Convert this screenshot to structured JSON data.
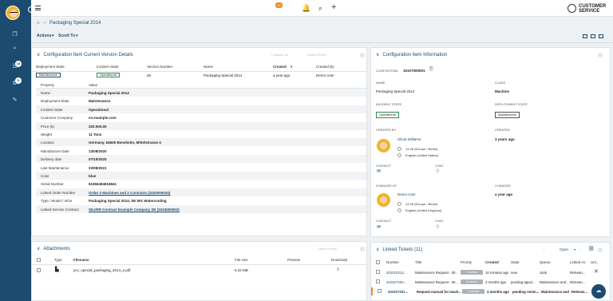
{
  "topbar": {
    "notifications_count": "12"
  },
  "brand": {
    "line1": "CUSTOMER",
    "line2": "SERVICE"
  },
  "breadcrumb": {
    "title": "Packaging Special 2014"
  },
  "actions": {
    "actions_label": "Actions",
    "scroll_label": "Scroll To"
  },
  "sidebar": {
    "badge1": "23",
    "badge2": "9"
  },
  "versions": {
    "title": "Configuration Item Current Version Details",
    "ghost1": "Collapse All",
    "ghost2": "Select Preset",
    "headers": [
      "Deployment State",
      "Incident State",
      "Version Number",
      "Name",
      "Created",
      "Created By"
    ],
    "row": {
      "deployment": "Maintenance",
      "incident": "Operational",
      "version": "26",
      "name": "Packaging Special 2014",
      "created": "a year ago",
      "created_by": "Demo User"
    },
    "prop_header": "Property",
    "value_header": "Value",
    "props": [
      {
        "k": "Name",
        "v": "Packaging Special 2014"
      },
      {
        "k": "Deployment State",
        "v": "Maintenance"
      },
      {
        "k": "Incident State",
        "v": "Operational"
      },
      {
        "k": "Customer Company",
        "v": "ex.example.com"
      },
      {
        "k": "Price (€)",
        "v": "220.000,00"
      },
      {
        "k": "Weight",
        "v": "11 Tons"
      },
      {
        "k": "Location",
        "v": "Germany, 64625 Bensheim, Mittelstrasse 4"
      },
      {
        "k": "Manufacture Date",
        "v": "13/08/2020"
      },
      {
        "k": "Delivery date",
        "v": "07/10/2020"
      },
      {
        "k": "Last Maintenance",
        "v": "23/09/2021"
      },
      {
        "k": "Color",
        "v": "blue"
      },
      {
        "k": "Serial Number",
        "v": "61556484616841"
      },
      {
        "k": "Linked Order Number",
        "v": "Order 2 Machines and 2 Contracts (1020000034)"
      },
      {
        "k": "Type / Model / Infos",
        "v": "Packaging Special 2014, SE 501 Watercooling"
      },
      {
        "k": "Linked Service Contract",
        "v": "SILVER Contract Example Company SE (1024000002)"
      }
    ]
  },
  "attachments": {
    "title": "Attachments",
    "ghost": "Select Preset",
    "headers": {
      "type": "Type",
      "filename": "Filename",
      "size": "File size",
      "preview": "Preview",
      "download": "Download"
    },
    "file": {
      "name": "pcc_special_packaging_2014_e.pdf",
      "size": "6.42 MB"
    }
  },
  "info": {
    "title": "Configuration Item Information",
    "configitem_label": "CONFIGITEM#",
    "configitem_value": "10107000001",
    "name_label": "NAME",
    "name_value": "Packaging Special 2014",
    "class_label": "CLASS",
    "class_value": "Machine",
    "incident_label": "INCIDENT STATE",
    "incident_value": "Operational",
    "deployment_label": "DEPLOYMENT STATE",
    "deployment_value": "Maintenance",
    "created_by_label": "CREATED BY",
    "created_label": "CREATED",
    "created_value": "3 years ago",
    "creator_name": "Olivia Williams",
    "creator_time": "14:28 (Europe / Berlin)",
    "creator_lang": "English (United States)",
    "contact_label": "CONTACT",
    "chat_label": "CHAT",
    "changed_by_label": "CHANGED BY",
    "changed_label": "CHANGED",
    "changed_value": "a year ago",
    "changer_name": "Demo User",
    "changer_time": "14:28 (Europe / Berlin)",
    "changer_lang": "English (United Kingdom)"
  },
  "tickets": {
    "title": "Linked Tickets (11)",
    "open_label": "Open",
    "headers": [
      "Number",
      "Title",
      "Priority",
      "Created",
      "State",
      "Queue",
      "Linked As",
      "Unl..."
    ],
    "rows": [
      {
        "number": "202310313...",
        "title": "Maintenance Request - 20...",
        "priority": "3 normal",
        "created": "10 minutes ago",
        "state": "new",
        "queue": "Junk",
        "linked": "Relevan..."
      },
      {
        "number": "202307203...",
        "title": "Maintenance Request - 20...",
        "priority": "3 normal",
        "created": "3 months ago",
        "state": "pending appoi...",
        "queue": "Maintenance and ...",
        "linked": "Relevan..."
      },
      {
        "number": "202307201...",
        "title": "Request manual for mach...",
        "priority": "3 normal",
        "created": "3 months ago",
        "state": "pending remin...",
        "queue": "Maintenance and ...",
        "linked": "Relevan..."
      }
    ]
  }
}
